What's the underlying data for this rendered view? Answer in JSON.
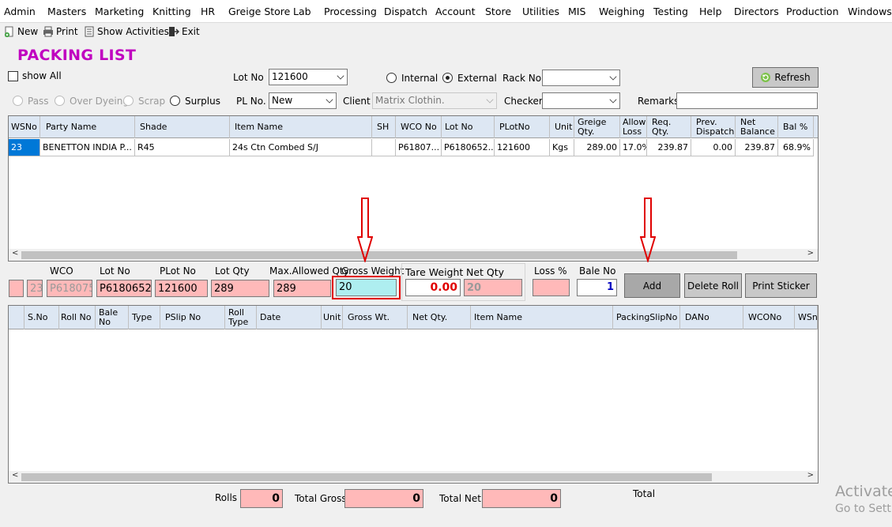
{
  "menu": [
    "Admin",
    "Masters",
    "Marketing",
    "Knitting",
    "HR",
    "Greige Store",
    "Lab",
    "Processing",
    "Dispatch",
    "Account",
    "Store",
    "Utilities",
    "MIS",
    "Weighing",
    "Testing",
    "Help",
    "Directors",
    "Production",
    "Windows"
  ],
  "toolbar": {
    "new": "New",
    "print": "Print",
    "show_activities": "Show Activities",
    "exit": "Exit"
  },
  "form": {
    "title": "PACKING LIST",
    "show_all_label": "show All",
    "lot_no_label": "Lot No",
    "lot_no_value": "121600",
    "internal_label": "Internal",
    "external_label": "External",
    "rack_no_label": "Rack No",
    "rack_no_value": "",
    "refresh_label": "Refresh",
    "pass_label": "Pass",
    "over_dyeing_label": "Over Dyeing",
    "scrap_label": "Scrap",
    "surplus_label": "Surplus",
    "pl_no_label": "PL No.",
    "pl_no_value": "New",
    "client_label": "Client",
    "client_value": "Matrix Clothin.",
    "checker_label": "Checker",
    "checker_value": "",
    "remarks_label": "Remarks",
    "remarks_value": ""
  },
  "grid1": {
    "headers": [
      "WSNo",
      "Party Name",
      "Shade",
      "Item Name",
      "SH",
      "WCO No",
      "Lot No",
      "PLotNo",
      "Unit",
      "Greige Qty.",
      "Allowe Loss",
      "Req. Qty.",
      "Prev. Dispatch",
      "Net Balance",
      "Bal %"
    ],
    "row": [
      "23",
      "BENETTON INDIA P...",
      "R45",
      "24s Ctn Combed S/J",
      "",
      "P61807...",
      "P6180652...",
      "121600",
      "Kgs",
      "289.00",
      "17.0%",
      "239.87",
      "0.00",
      "239.87",
      "68.9%"
    ]
  },
  "entry": {
    "ws_no": "23",
    "wco_label": "WCO",
    "wco_value": "P618075",
    "lot_no_label": "Lot No",
    "lot_no_value": "P6180652",
    "plot_no_label": "PLot No",
    "plot_no_value": "121600",
    "lot_qty_label": "Lot Qty",
    "lot_qty_value": "289",
    "max_allowed_label": "Max.Allowed Qty",
    "max_allowed_value": "289",
    "gross_weight_label": "Gross Weight",
    "gross_weight_value": "20",
    "tare_weight_label": "Tare Weight",
    "tare_weight_value": "0.00",
    "net_qty_label": "Net Qty",
    "net_qty_value": "20",
    "loss_label": "Loss %",
    "loss_value": "",
    "bale_no_label": "Bale No",
    "bale_no_value": "1",
    "add_label": "Add",
    "delete_roll_label": "Delete Roll",
    "print_sticker_label": "Print Sticker"
  },
  "grid2": {
    "headers": [
      "",
      "S.No",
      "Roll No",
      "Bale No",
      "Type",
      "PSlip No",
      "Roll Type",
      "Date",
      "Unit",
      "Gross Wt.",
      "Net Qty.",
      "Item Name",
      "PackingSlipNo",
      "DANo",
      "WCONo",
      "WSno"
    ]
  },
  "totals": {
    "rolls_label": "Rolls",
    "rolls_value": "0",
    "total_gross_label": "Total Gross",
    "total_gross_value": "0",
    "total_net_label": "Total Net",
    "total_net_value": "0",
    "total_label": "Total"
  },
  "watermark": {
    "line1": "Activate",
    "line2": "Go to Setti"
  },
  "colors": {
    "title": "#c000c0",
    "pink": "#ffb9b9",
    "cyan": "#aeeef0",
    "annotation_red": "#e00000",
    "header_blue": "#dde7f3",
    "selected_blue": "#0078d7"
  }
}
